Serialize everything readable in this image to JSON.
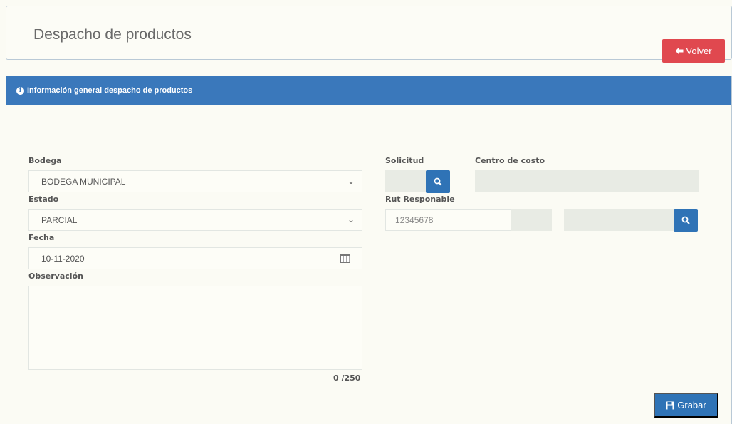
{
  "page": {
    "title": "Despacho de productos"
  },
  "panel": {
    "header": "Información general despacho de productos"
  },
  "actions": {
    "volver_label": "Volver",
    "grabar_label": "Grabar"
  },
  "form": {
    "bodega": {
      "label": "Bodega",
      "value": "BODEGA MUNICIPAL"
    },
    "estado": {
      "label": "Estado",
      "value": "PARCIAL"
    },
    "fecha": {
      "label": "Fecha",
      "value": "10-11-2020"
    },
    "observacion": {
      "label": "Observación",
      "value": "",
      "counter": "0 /250"
    },
    "solicitud": {
      "label": "Solicitud",
      "value": ""
    },
    "centro_costo": {
      "label": "Centro de costo",
      "value": ""
    },
    "rut_responsable": {
      "label": "Rut Responable",
      "value": "12345678"
    }
  },
  "colors": {
    "header": "#3a78bb",
    "danger": "#e0484f",
    "primary": "#2f73b6"
  },
  "icons": {
    "info": "info-icon",
    "back": "arrow-left-icon",
    "search": "search-icon",
    "save": "floppy-disk-icon",
    "calendar": "calendar-icon",
    "chevron": "chevron-down-icon"
  }
}
